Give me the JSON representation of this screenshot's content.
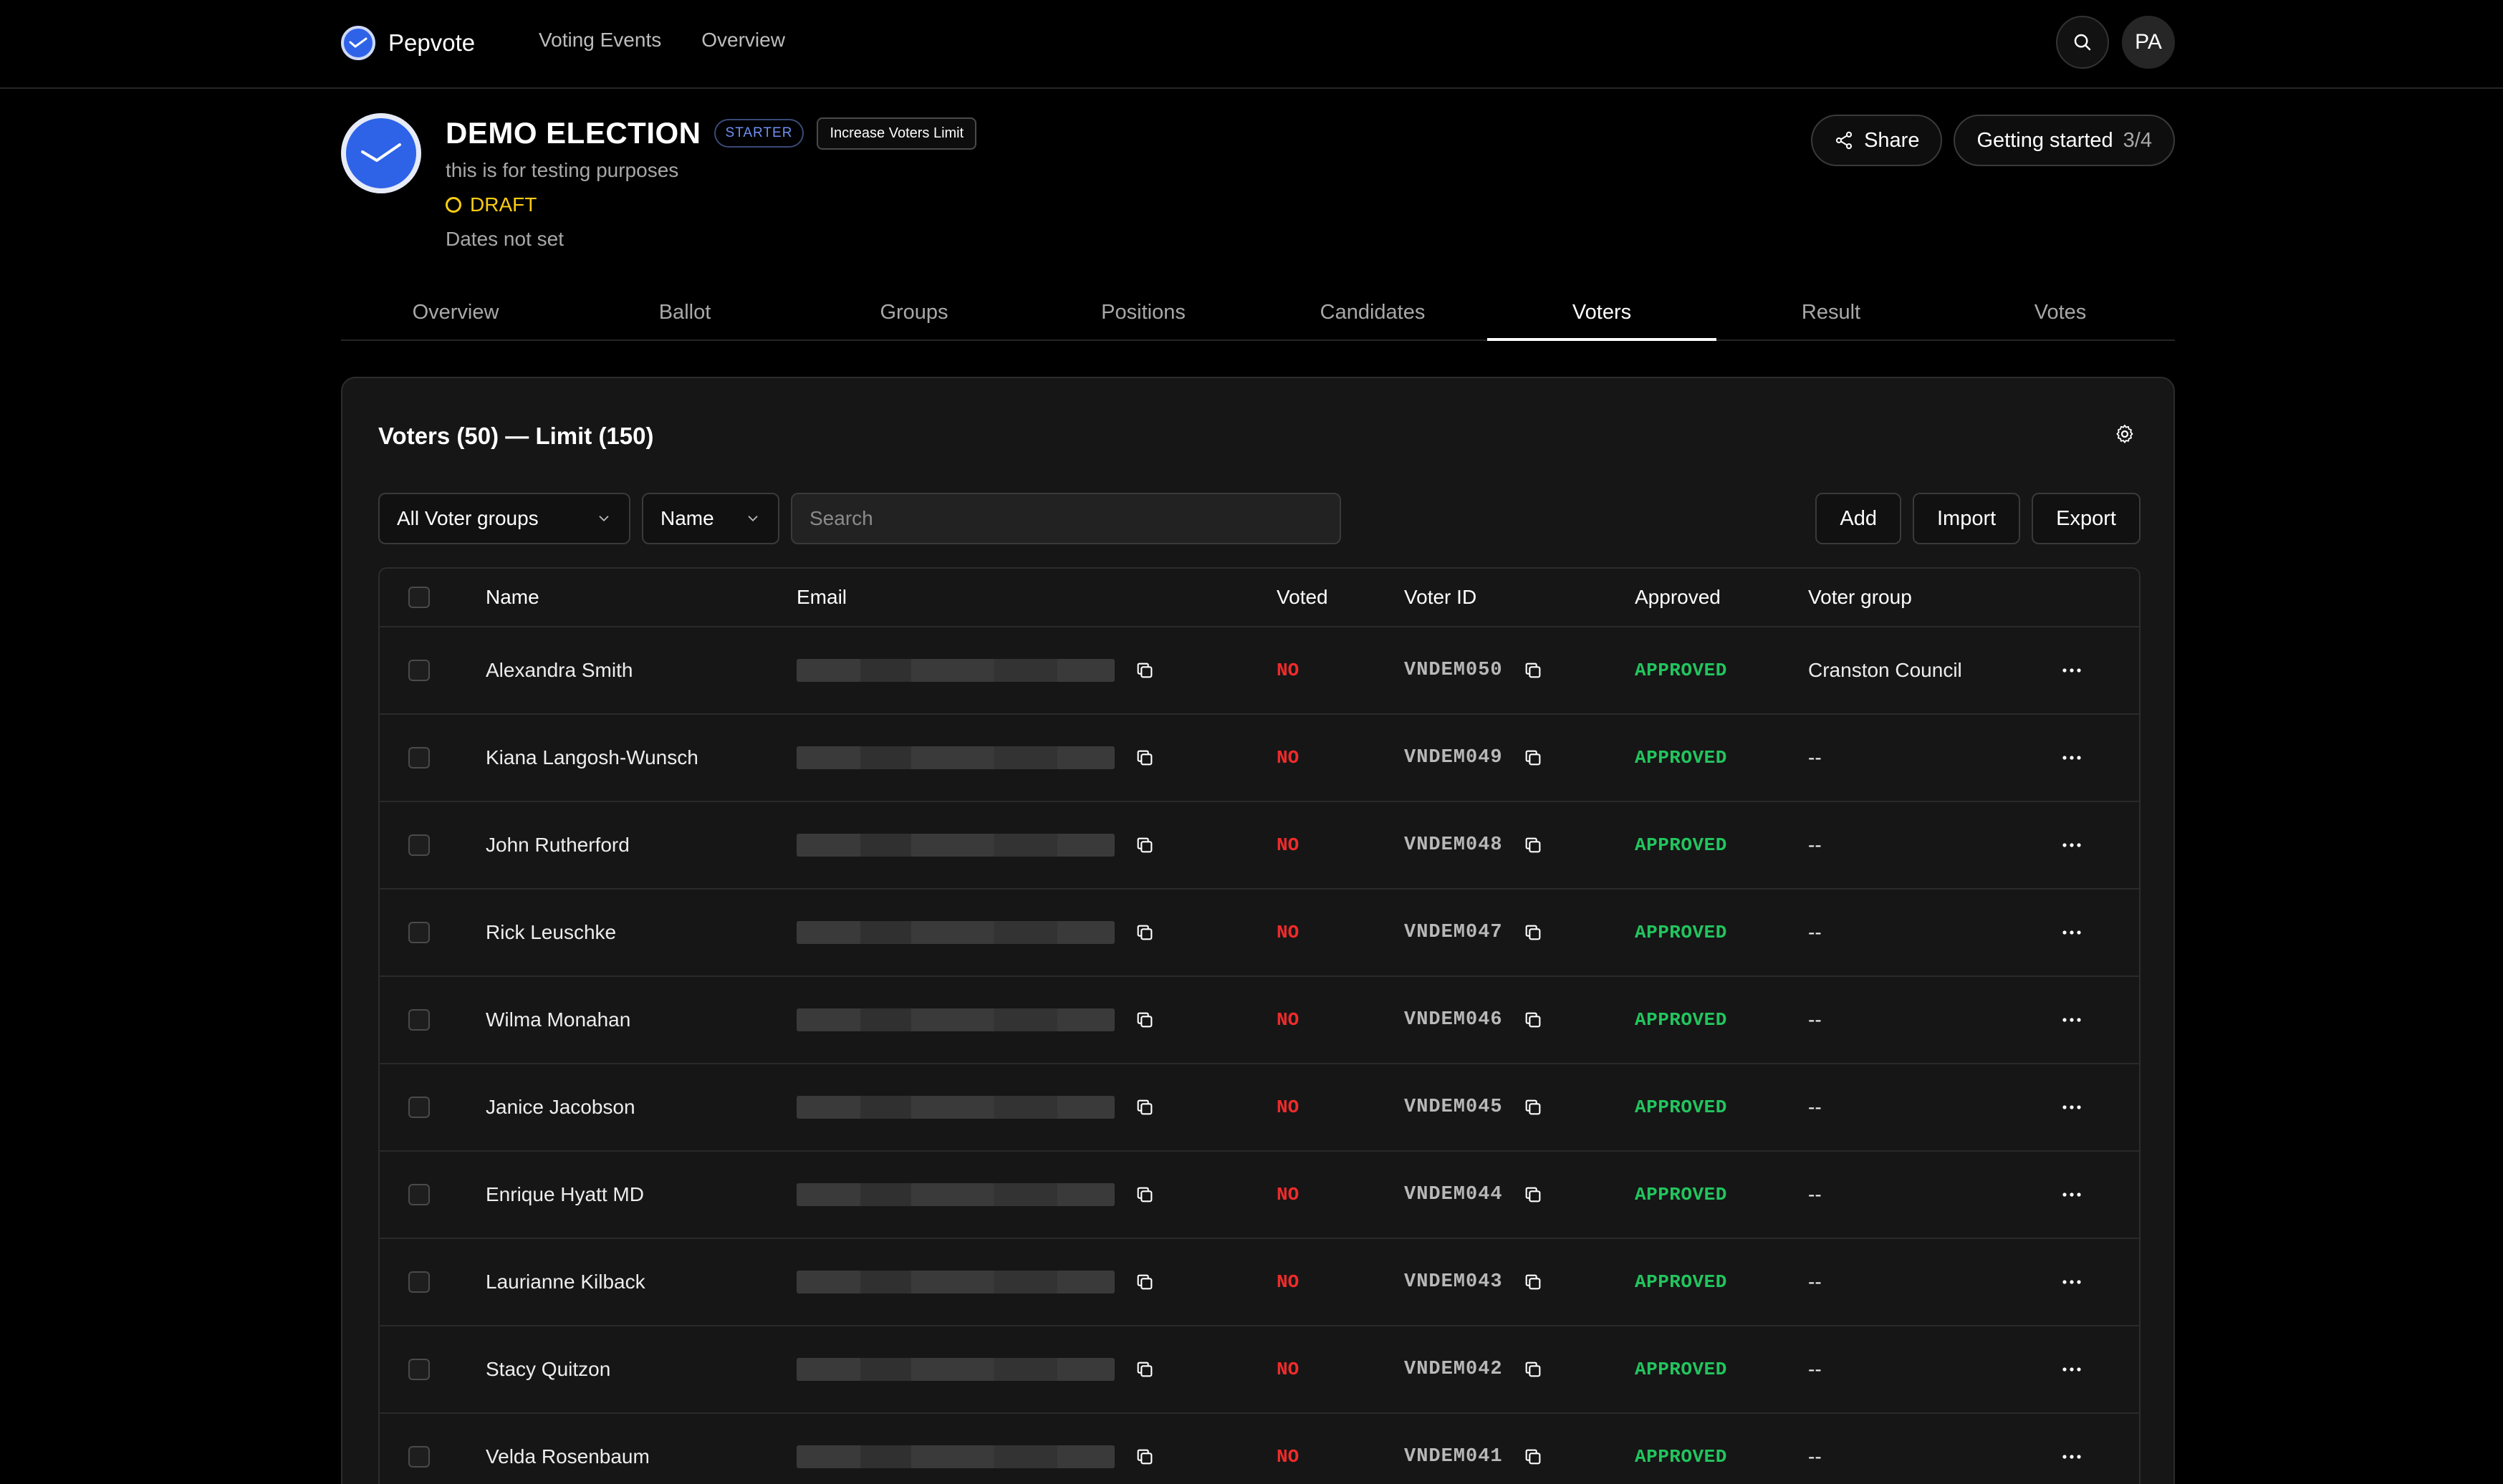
{
  "nav": {
    "brand": "Pepvote",
    "links": [
      "Voting Events",
      "Overview"
    ],
    "avatar": "PA"
  },
  "election": {
    "title": "DEMO ELECTION",
    "plan_badge": "STARTER",
    "limit_button": "Increase Voters Limit",
    "description": "this is for testing purposes",
    "status": "DRAFT",
    "dates": "Dates not set",
    "share_label": "Share",
    "getting_started_label": "Getting started",
    "getting_started_progress": "3/4"
  },
  "tabs": [
    "Overview",
    "Ballot",
    "Groups",
    "Positions",
    "Candidates",
    "Voters",
    "Result",
    "Votes"
  ],
  "active_tab": "Voters",
  "voters": {
    "heading": "Voters (50) — Limit (150)",
    "group_filter": "All Voter groups",
    "field_filter": "Name",
    "search_placeholder": "Search",
    "buttons": {
      "add": "Add",
      "import": "Import",
      "export": "Export"
    },
    "columns": {
      "name": "Name",
      "email": "Email",
      "voted": "Voted",
      "voter_id": "Voter ID",
      "approved": "Approved",
      "voter_group": "Voter group"
    },
    "rows": [
      {
        "name": "Alexandra Smith",
        "voted": "NO",
        "voter_id": "VNDEM050",
        "approved": "APPROVED",
        "group": "Cranston Council"
      },
      {
        "name": "Kiana Langosh-Wunsch",
        "voted": "NO",
        "voter_id": "VNDEM049",
        "approved": "APPROVED",
        "group": "--"
      },
      {
        "name": "John Rutherford",
        "voted": "NO",
        "voter_id": "VNDEM048",
        "approved": "APPROVED",
        "group": "--"
      },
      {
        "name": "Rick Leuschke",
        "voted": "NO",
        "voter_id": "VNDEM047",
        "approved": "APPROVED",
        "group": "--"
      },
      {
        "name": "Wilma Monahan",
        "voted": "NO",
        "voter_id": "VNDEM046",
        "approved": "APPROVED",
        "group": "--"
      },
      {
        "name": "Janice Jacobson",
        "voted": "NO",
        "voter_id": "VNDEM045",
        "approved": "APPROVED",
        "group": "--"
      },
      {
        "name": "Enrique Hyatt MD",
        "voted": "NO",
        "voter_id": "VNDEM044",
        "approved": "APPROVED",
        "group": "--"
      },
      {
        "name": "Laurianne Kilback",
        "voted": "NO",
        "voter_id": "VNDEM043",
        "approved": "APPROVED",
        "group": "--"
      },
      {
        "name": "Stacy Quitzon",
        "voted": "NO",
        "voter_id": "VNDEM042",
        "approved": "APPROVED",
        "group": "--"
      },
      {
        "name": "Velda Rosenbaum",
        "voted": "NO",
        "voter_id": "VNDEM041",
        "approved": "APPROVED",
        "group": "--"
      }
    ]
  },
  "colors": {
    "accent": "#2e63e8",
    "draft": "#facc15",
    "voted_no": "#ef2b2b",
    "approved": "#22c55e"
  },
  "icons": {
    "search": "search-icon",
    "share": "share-icon",
    "settings": "gear-icon",
    "copy": "copy-icon",
    "more": "more-icon",
    "chevron": "chevron-down-icon",
    "logo": "checkmark-logo-icon"
  }
}
